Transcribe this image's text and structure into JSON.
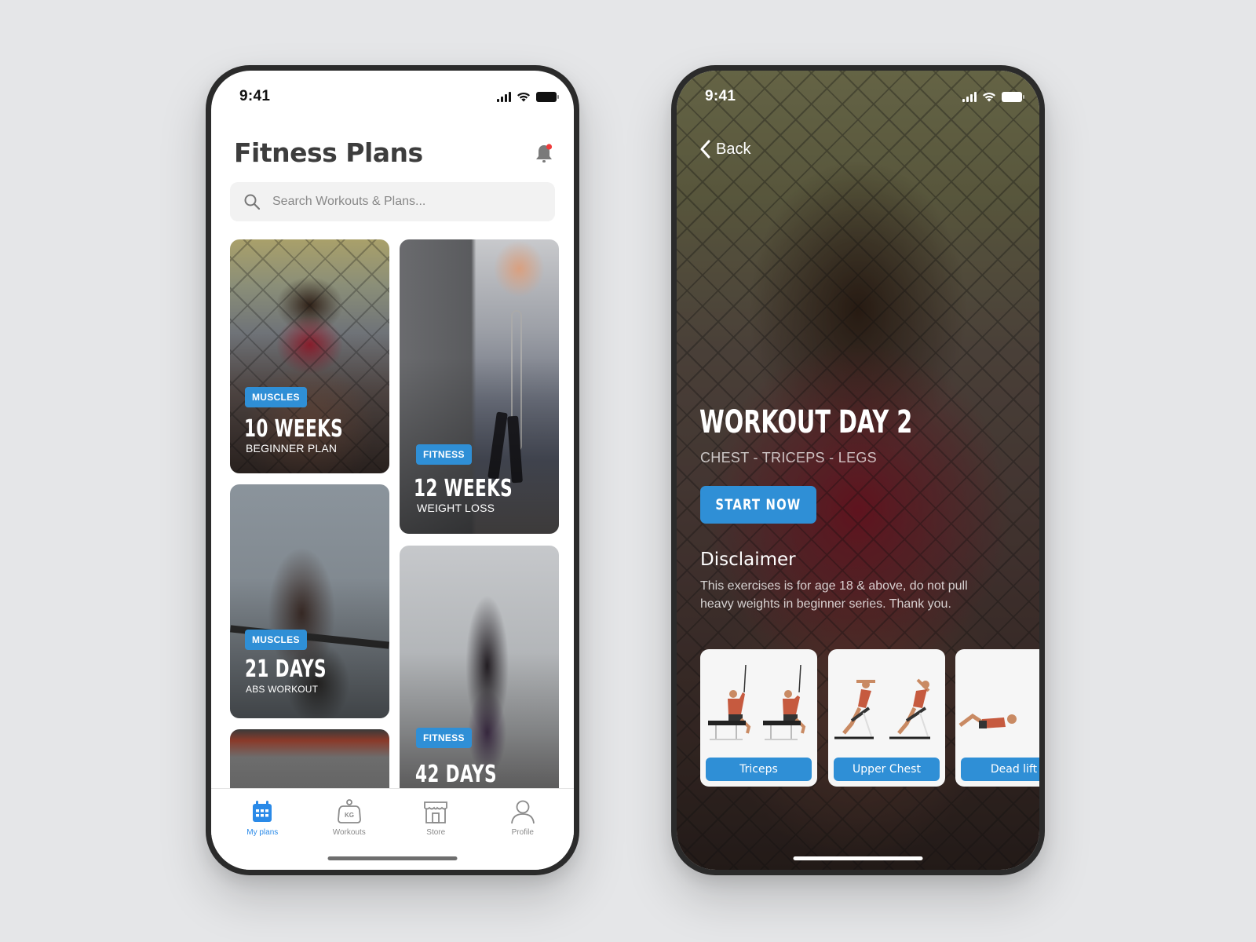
{
  "colors": {
    "accent": "#2f8fd6",
    "tab_active": "#2a8ae8",
    "tab_inactive": "#8a8a8a",
    "notification_dot": "#ef3b3b",
    "background": "#e5e6e8"
  },
  "left_screen": {
    "status_bar": {
      "time": "9:41"
    },
    "header": {
      "title": "Fitness Plans",
      "notification_icon": "bell-icon"
    },
    "search": {
      "placeholder": "Search Workouts & Plans...",
      "value": "",
      "icon": "search-icon"
    },
    "plans": [
      {
        "badge": "MUSCLES",
        "title": "10 WEEKS",
        "subtitle": "BEGINNER PLAN"
      },
      {
        "badge": "FITNESS",
        "title": "12 WEEKS",
        "subtitle": "WEIGHT LOSS"
      },
      {
        "badge": "MUSCLES",
        "title": "21 DAYS",
        "subtitle": "ABS WORKOUT"
      },
      {
        "badge": "FITNESS",
        "title": "42 DAYS",
        "subtitle": ""
      },
      {
        "badge": "",
        "title": "",
        "subtitle": ""
      }
    ],
    "tab_bar": {
      "active": "My plans",
      "tabs": [
        {
          "label": "My plans",
          "icon": "calendar-icon"
        },
        {
          "label": "Workouts",
          "icon": "kettlebell-icon",
          "icon_text": "KG"
        },
        {
          "label": "Store",
          "icon": "store-icon"
        },
        {
          "label": "Profile",
          "icon": "user-icon"
        }
      ]
    }
  },
  "right_screen": {
    "status_bar": {
      "time": "9:41"
    },
    "back_label": "Back",
    "workout": {
      "title": "WORKOUT DAY 2",
      "subtitle": "CHEST - TRICEPS - LEGS",
      "start_label": "START NOW"
    },
    "disclaimer": {
      "title": "Disclaimer",
      "text": "This exercises is for age 18 & above, do not pull heavy weights in beginner series. Thank you."
    },
    "exercises": [
      {
        "label": "Triceps"
      },
      {
        "label": "Upper Chest"
      },
      {
        "label": "Dead lift"
      }
    ]
  }
}
